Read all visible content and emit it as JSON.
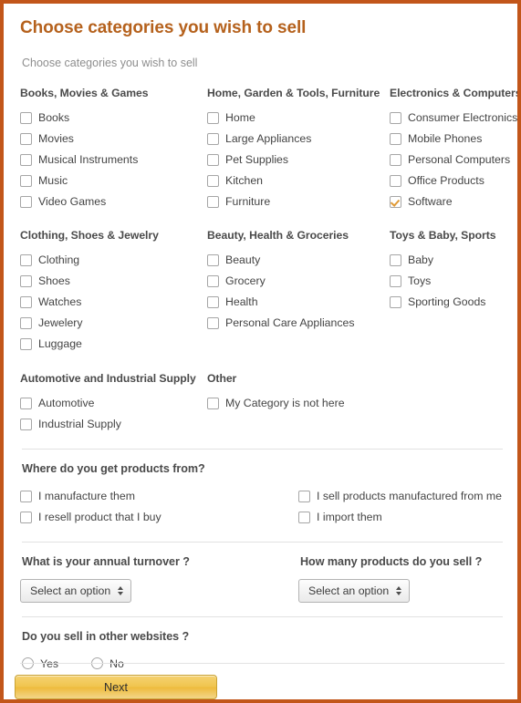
{
  "page": {
    "title": "Choose categories you wish to sell",
    "subtitle": "Choose categories you wish to sell"
  },
  "categories": {
    "row1": [
      {
        "title": "Books, Movies & Games",
        "items": [
          {
            "label": "Books",
            "checked": false
          },
          {
            "label": "Movies",
            "checked": false
          },
          {
            "label": "Musical Instruments",
            "checked": false
          },
          {
            "label": "Music",
            "checked": false
          },
          {
            "label": "Video Games",
            "checked": false
          }
        ]
      },
      {
        "title": "Home, Garden & Tools, Furniture",
        "items": [
          {
            "label": "Home",
            "checked": false
          },
          {
            "label": "Large Appliances",
            "checked": false
          },
          {
            "label": "Pet Supplies",
            "checked": false
          },
          {
            "label": "Kitchen",
            "checked": false
          },
          {
            "label": "Furniture",
            "checked": false
          }
        ]
      },
      {
        "title": "Electronics & Computers",
        "items": [
          {
            "label": "Consumer Electronics",
            "checked": false
          },
          {
            "label": "Mobile Phones",
            "checked": false
          },
          {
            "label": "Personal Computers",
            "checked": false
          },
          {
            "label": "Office Products",
            "checked": false
          },
          {
            "label": "Software",
            "checked": true
          }
        ]
      }
    ],
    "row2": [
      {
        "title": "Clothing, Shoes & Jewelry",
        "items": [
          {
            "label": "Clothing",
            "checked": false
          },
          {
            "label": "Shoes",
            "checked": false
          },
          {
            "label": "Watches",
            "checked": false
          },
          {
            "label": "Jewelery",
            "checked": false
          },
          {
            "label": "Luggage",
            "checked": false
          }
        ]
      },
      {
        "title": "Beauty, Health & Groceries",
        "items": [
          {
            "label": "Beauty",
            "checked": false
          },
          {
            "label": "Grocery",
            "checked": false
          },
          {
            "label": "Health",
            "checked": false
          },
          {
            "label": "Personal Care Appliances",
            "checked": false
          }
        ]
      },
      {
        "title": "Toys & Baby, Sports",
        "items": [
          {
            "label": "Baby",
            "checked": false
          },
          {
            "label": "Toys",
            "checked": false
          },
          {
            "label": "Sporting Goods",
            "checked": false
          }
        ]
      }
    ],
    "row3": [
      {
        "title": "Automotive and Industrial Supply",
        "items": [
          {
            "label": "Automotive",
            "checked": false
          },
          {
            "label": "Industrial Supply",
            "checked": false
          }
        ]
      },
      {
        "title": "Other",
        "items": [
          {
            "label": "My Category is not here",
            "checked": false
          }
        ]
      }
    ]
  },
  "sourcing": {
    "title": "Where do you get products from?",
    "options": [
      {
        "label": "I manufacture them",
        "checked": false
      },
      {
        "label": "I sell products manufactured from me",
        "checked": false
      },
      {
        "label": "I resell product that I buy",
        "checked": false
      },
      {
        "label": "I import them",
        "checked": false
      }
    ]
  },
  "questions": {
    "turnover": {
      "label": "What is your annual turnover ?",
      "select_value": "Select an option"
    },
    "products_count": {
      "label": "How many products do you sell ?",
      "select_value": "Select an option"
    }
  },
  "other_websites": {
    "title": "Do you sell in other websites ?",
    "options": [
      {
        "label": "Yes",
        "selected": false
      },
      {
        "label": "No",
        "selected": false
      }
    ]
  },
  "footer": {
    "next_label": "Next"
  },
  "colors": {
    "border": "#c2561a",
    "title": "#b5611c",
    "checkmark": "#e09a36",
    "button_gold": "#f0c54f"
  }
}
